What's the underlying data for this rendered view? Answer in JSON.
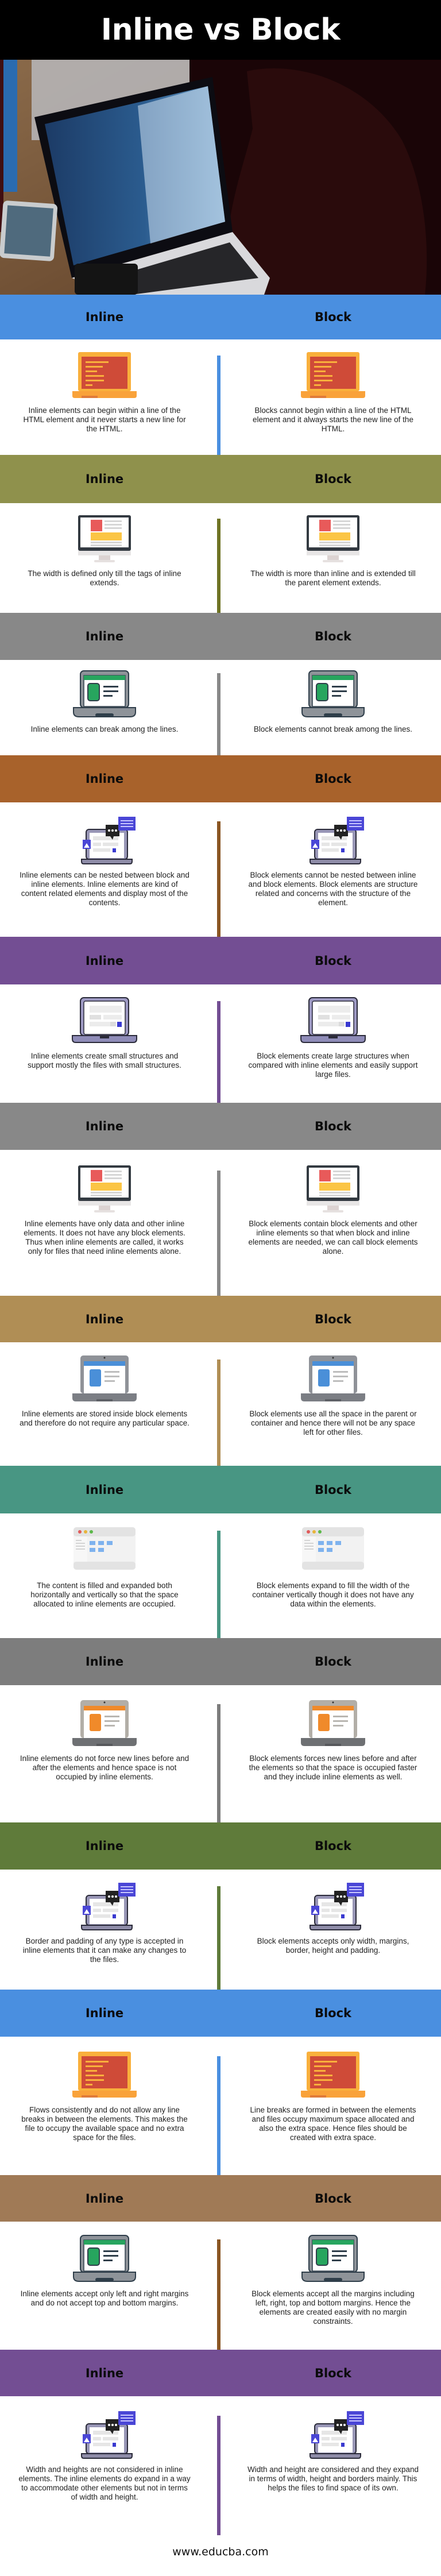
{
  "title": "Inline vs Block",
  "footer": "www.educba.com",
  "column_labels": {
    "left": "Inline",
    "right": "Block"
  },
  "sections": [
    {
      "header_color": "#4a8fe0",
      "divider_color": "#4a8fe0",
      "icon": "orange-laptop-code-icon",
      "inline": "Inline elements can begin within a line of the HTML element and it never starts a new line for the HTML.",
      "block": "Blocks cannot begin within a line of the HTML element and it always starts the new line of the HTML."
    },
    {
      "header_color": "#8f914c",
      "divider_color": "#6f7424",
      "icon": "desktop-monitor-icon",
      "inline": "The width is defined only till the tags of inline extends.",
      "block": "The width is more than inline and is extended till the parent element extends."
    },
    {
      "header_color": "#888888",
      "divider_color": "#888888",
      "icon": "green-laptop-icon",
      "inline": "Inline elements can break among the lines.",
      "block": "Block elements cannot break among the lines."
    },
    {
      "header_color": "#a8622b",
      "divider_color": "#8a5623",
      "icon": "laptop-chat-bubbles-icon",
      "inline": "Inline elements can be nested between block and inline elements. Inline elements are kind of content related elements and display most of the contents.",
      "block": "Block elements cannot be nested between inline and block elements. Block elements are structure related and concerns with the structure of the element."
    },
    {
      "header_color": "#734e93",
      "divider_color": "#734e93",
      "icon": "purple-laptop-icon",
      "inline": "Inline elements create small structures and support mostly the files with small structures.",
      "block": "Block elements create large structures when compared with inline elements and easily support large files."
    },
    {
      "header_color": "#888888",
      "divider_color": "#888888",
      "icon": "desktop-monitor-icon",
      "inline": "Inline elements have only data and other inline elements. It does not have any block elements. Thus when inline elements are called, it works only for files that need inline elements alone.",
      "block": "Block elements contain block elements and other inline elements so that when block and inline elements are needed, we can call block elements alone."
    },
    {
      "header_color": "#b08e55",
      "divider_color": "#b08e55",
      "icon": "blue-laptop-icon",
      "inline": "Inline elements are stored inside block elements and therefore do not require any particular space.",
      "block": "Block elements use all the space in the parent or container and hence there will not be any space left for other files."
    },
    {
      "header_color": "#489683",
      "divider_color": "#489683",
      "icon": "browser-window-grid-icon",
      "inline": "The content is filled and expanded both horizontally and vertically so that the space allocated to inline elements are occupied.",
      "block": "Block elements expand to fill the width of the container vertically though it does not have any data within the elements."
    },
    {
      "header_color": "#7d7d7d",
      "divider_color": "#7d7d7d",
      "icon": "orange-laptop-icon",
      "inline": "Inline elements do not force new lines before and after the elements and hence space is not occupied by inline elements.",
      "block": "Block elements forces new lines before and after the elements so that the space is occupied faster and they include inline elements as well."
    },
    {
      "header_color": "#5f7b3a",
      "divider_color": "#5f7b3a",
      "icon": "laptop-chat-bubbles-icon",
      "inline": "Border and padding of any type is accepted in inline elements that it can make any changes to the files.",
      "block": "Block elements accepts only width, margins, border, height and padding."
    },
    {
      "header_color": "#4a8fe0",
      "divider_color": "#4a8fe0",
      "icon": "orange-laptop-code-icon",
      "inline": "Flows consistently and do not allow any line breaks in between the elements. This makes the file to occupy the available space and no extra space for the files.",
      "block": "Line breaks are formed in between the elements and files occupy maximum space allocated and also the extra space. Hence files should be created with extra space."
    },
    {
      "header_color": "#a07a56",
      "divider_color": "#8a5623",
      "icon": "green-laptop-icon",
      "inline": "Inline elements accept only left and right margins and do not accept top and bottom margins.",
      "block": "Block elements accept all the margins including left, right, top and bottom margins. Hence the elements are created easily with no margin constraints."
    },
    {
      "header_color": "#734e93",
      "divider_color": "#734e93",
      "icon": "laptop-chat-bubbles-icon",
      "inline": "Width and heights are not considered in inline elements. The inline elements do expand in a way to accommodate other elements but not in terms of width and height.",
      "block": "Width and height are considered and they expand in terms of width, height and borders mainly. This helps the files to find space of its own."
    }
  ]
}
